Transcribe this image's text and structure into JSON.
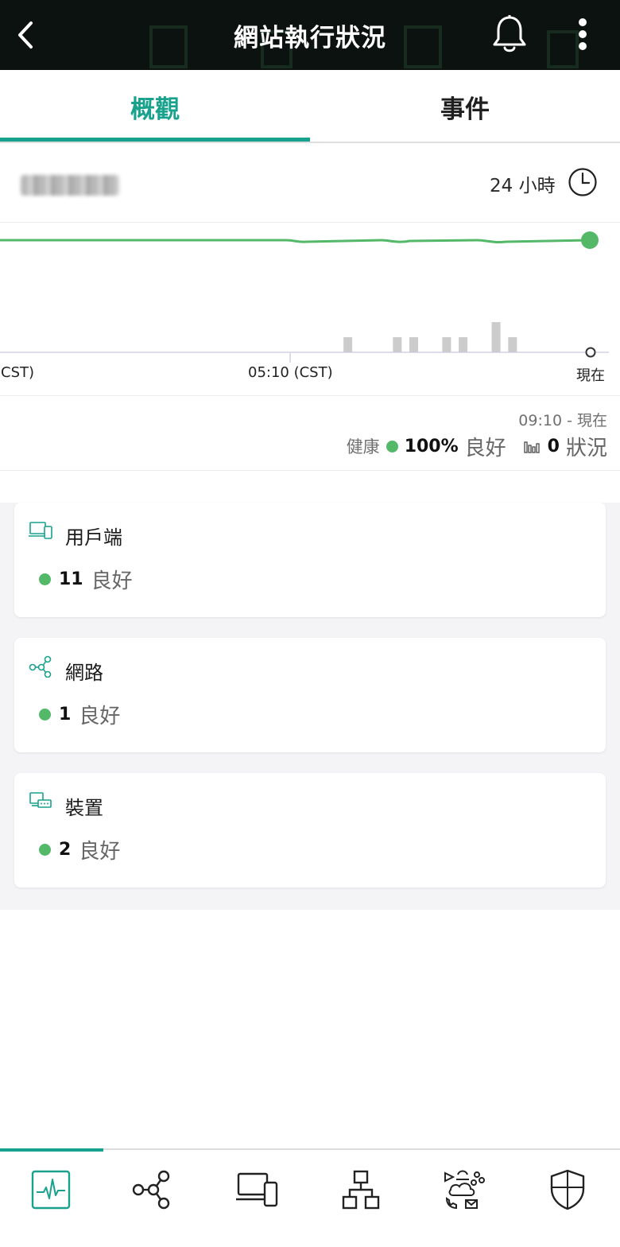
{
  "header": {
    "title": "網站執行狀況",
    "back_icon": "chevron-left-icon",
    "bell_icon": "bell-icon",
    "more_icon": "more-vertical-icon"
  },
  "tabs": [
    {
      "label": "概觀",
      "active": true
    },
    {
      "label": "事件",
      "active": false
    }
  ],
  "site": {
    "range_label": "24 小時"
  },
  "chart_data": {
    "type": "line",
    "title": "",
    "xlabel": "",
    "ylabel": "",
    "x_tick_labels": [
      "(CST)",
      "05:10 (CST)",
      "現在"
    ],
    "series": [
      {
        "values": [
          100,
          100,
          100,
          100,
          100,
          100,
          100
        ]
      }
    ],
    "event_bars": [
      0,
      0,
      0,
      1,
      0,
      0,
      1,
      1,
      0,
      1,
      1,
      0,
      2,
      1,
      0
    ],
    "line_color": "#53b969",
    "bar_color": "#cccccc"
  },
  "summary": {
    "time_range": "09:10 - 現在",
    "health_label": "健康",
    "health_value": "100%",
    "health_word": "良好",
    "issues_value": "0",
    "issues_word": "狀況"
  },
  "cards": [
    {
      "title": "用戶端",
      "count": "11",
      "status": "良好",
      "icon": "clients-icon"
    },
    {
      "title": "網路",
      "count": "1",
      "status": "良好",
      "icon": "network-icon"
    },
    {
      "title": "裝置",
      "count": "2",
      "status": "良好",
      "icon": "devices-icon"
    }
  ],
  "nav": [
    {
      "icon": "health-pulse-icon",
      "active": true
    },
    {
      "icon": "network-topology-icon",
      "active": false
    },
    {
      "icon": "devices-icon",
      "active": false
    },
    {
      "icon": "hierarchy-icon",
      "active": false
    },
    {
      "icon": "applications-icon",
      "active": false
    },
    {
      "icon": "security-shield-icon",
      "active": false
    }
  ],
  "colors": {
    "accent": "#18a28d",
    "good": "#53b969",
    "header_bg": "#0b120f"
  }
}
